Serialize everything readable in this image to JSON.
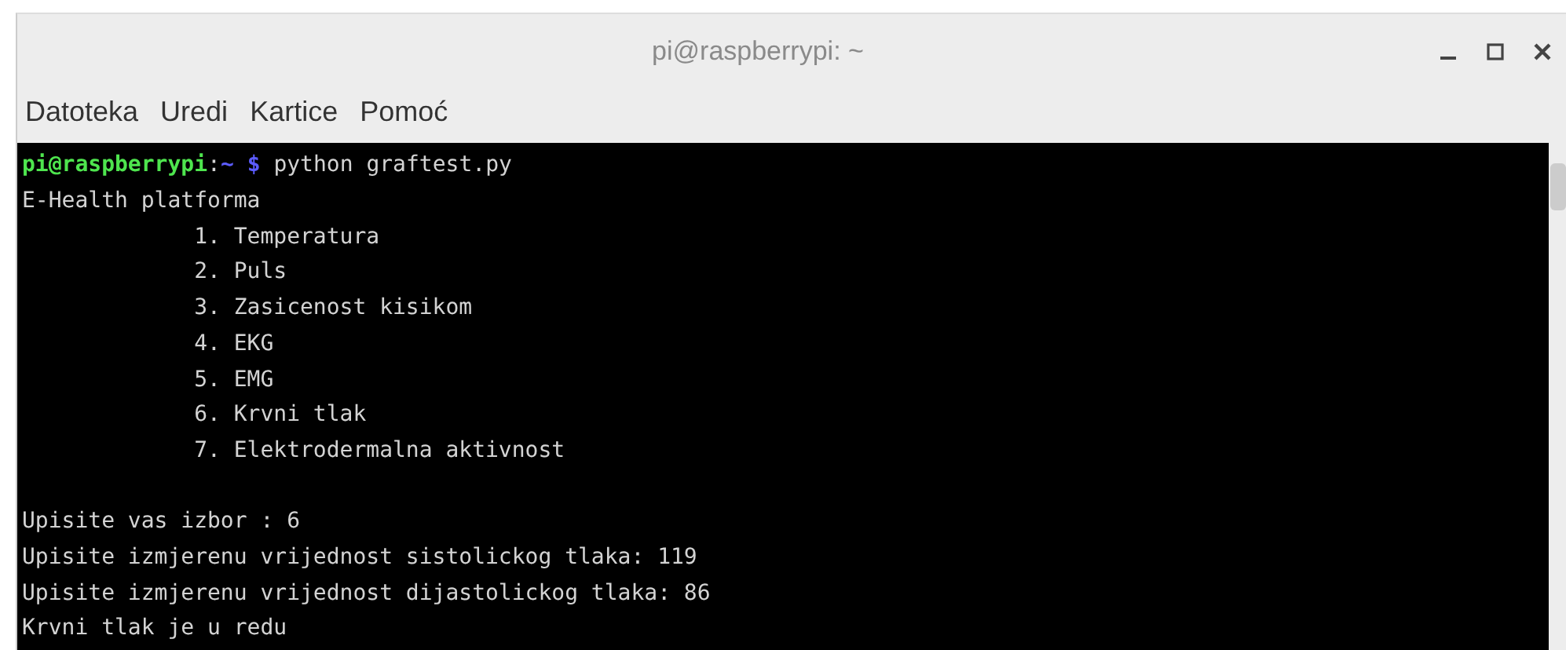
{
  "window": {
    "title": "pi@raspberrypi: ~"
  },
  "menu": [
    "Datoteka",
    "Uredi",
    "Kartice",
    "Pomoć"
  ],
  "terminal": {
    "lines": [
      {
        "kind": "prompt",
        "user_host": "pi@raspberrypi",
        "separator": ":",
        "path": "~",
        "symbol": "$",
        "command": "python graftest.py"
      },
      {
        "kind": "output",
        "text": "E-Health platforma"
      },
      {
        "kind": "output",
        "text": "             1. Temperatura"
      },
      {
        "kind": "output",
        "text": "             2. Puls"
      },
      {
        "kind": "output",
        "text": "             3. Zasicenost kisikom"
      },
      {
        "kind": "output",
        "text": "             4. EKG"
      },
      {
        "kind": "output",
        "text": "             5. EMG"
      },
      {
        "kind": "output",
        "text": "             6. Krvni tlak"
      },
      {
        "kind": "output",
        "text": "             7. Elektrodermalna aktivnost"
      },
      {
        "kind": "blank"
      },
      {
        "kind": "output",
        "text": "Upisite vas izbor : 6"
      },
      {
        "kind": "output",
        "text": "Upisite izmjerenu vrijednost sistolickog tlaka: 119"
      },
      {
        "kind": "output",
        "text": "Upisite izmjerenu vrijednost dijastolickog tlaka: 86"
      },
      {
        "kind": "output",
        "text": "Krvni tlak je u redu"
      }
    ]
  }
}
